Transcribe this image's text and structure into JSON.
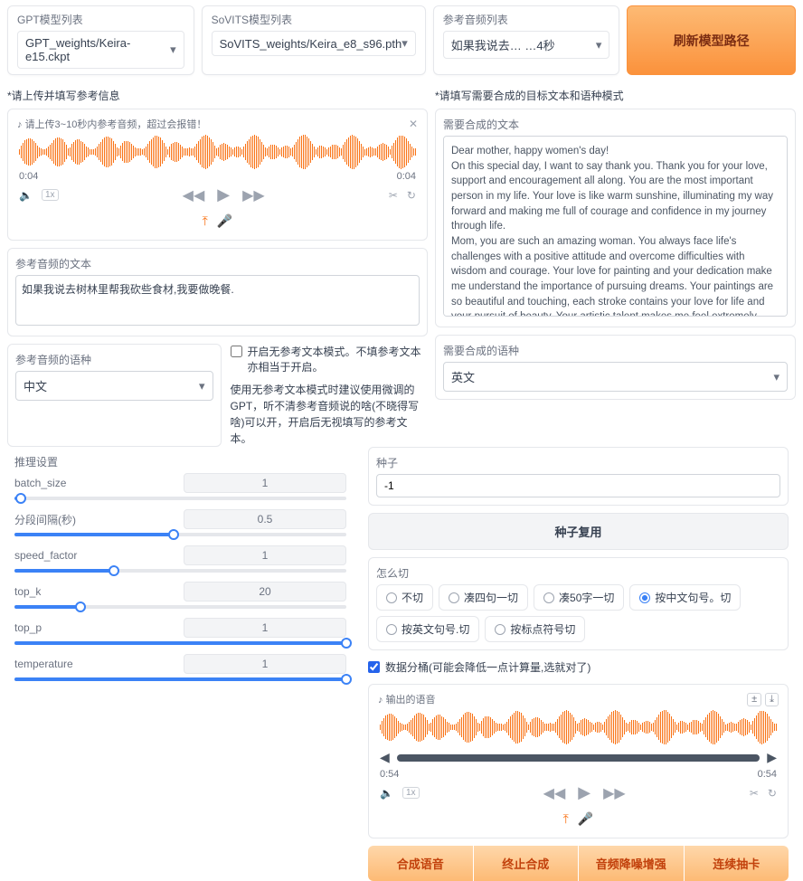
{
  "top": {
    "gpt_label": "GPT模型列表",
    "gpt_value": "GPT_weights/Keira-e15.ckpt",
    "sovits_label": "SoVITS模型列表",
    "sovits_value": "SoVITS_weights/Keira_e8_s96.pth",
    "ref_label": "参考音频列表",
    "ref_value": "如果我说去… …4秒",
    "refresh": "刷新模型路径"
  },
  "left": {
    "hint": "*请上传并填写参考信息",
    "upload_hint": "请上传3~10秒内参考音频，超过会报错！",
    "t0": "0:04",
    "t1": "0:04",
    "rate": "1x",
    "ref_text_label": "参考音频的文本",
    "ref_text_value": "如果我说去树林里帮我砍些食材,我要做晚餐.",
    "ref_lang_label": "参考音频的语种",
    "ref_lang_value": "中文",
    "mode_chk": "开启无参考文本模式。不填参考文本亦相当于开启。",
    "mode_note": "使用无参考文本模式时建议使用微调的GPT，听不清参考音频说的啥(不晓得写啥)可以开，开启后无视填写的参考文本。"
  },
  "right": {
    "hint": "*请填写需要合成的目标文本和语种模式",
    "target_label": "需要合成的文本",
    "target_text": "Dear mother, happy women's day!\nOn this special day, I want to say thank you. Thank you for your love, support and encouragement all along. You are the most important person in my life. Your love is like warm sunshine, illuminating my way forward and making me full of courage and confidence in my journey through life.\nMom, you are such an amazing woman. You always face life's challenges with a positive attitude and overcome difficulties with wisdom and courage. Your love for painting and your dedication make me understand the importance of pursuing dreams. Your paintings are so beautiful and touching, each stroke contains your love for life and your pursuit of beauty. Your artistic talent makes me feel extremely proud.\nOn this special day, I wish your life was as colorful as your paintings, and your heart would always be filled with artistic inspiration. May you be happy and happy every day, and may all your dreams come true.\nMom, I love you! Again, happy women's day!",
    "target_lang_label": "需要合成的语种",
    "target_lang_value": "英文"
  },
  "infer": {
    "title": "推理设置",
    "batch_size": {
      "label": "batch_size",
      "val": "1",
      "pct": 2
    },
    "split_interval": {
      "label": "分段间隔(秒)",
      "val": "0.5",
      "pct": 48
    },
    "speed_factor": {
      "label": "speed_factor",
      "val": "1",
      "pct": 30
    },
    "top_k": {
      "label": "top_k",
      "val": "20",
      "pct": 20
    },
    "top_p": {
      "label": "top_p",
      "val": "1",
      "pct": 100
    },
    "temperature": {
      "label": "temperature",
      "val": "1",
      "pct": 100
    }
  },
  "seed": {
    "label": "种子",
    "value": "-1",
    "reuse": "种子复用"
  },
  "cut": {
    "label": "怎么切",
    "opts": [
      "不切",
      "凑四句一切",
      "凑50字一切",
      "按中文句号。切",
      "按英文句号.切",
      "按标点符号切"
    ],
    "selected": 3
  },
  "bucket_chk": "数据分桶(可能会降低一点计算量,选就对了)",
  "output": {
    "label": "输出的语音",
    "t0": "0:54",
    "t1": "0:54",
    "rate": "1x"
  },
  "actions": [
    "合成语音",
    "终止合成",
    "音频降噪增强",
    "连续抽卡"
  ]
}
